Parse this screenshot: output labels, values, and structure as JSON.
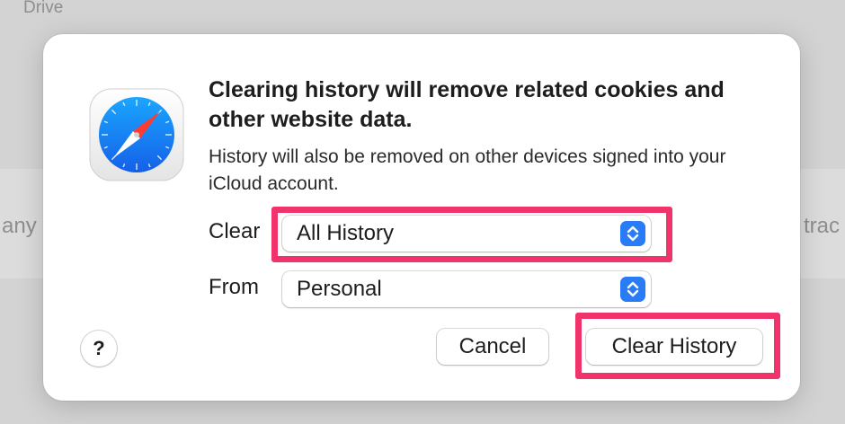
{
  "background": {
    "window_label": "Drive",
    "left_fragment": "any",
    "right_fragment": "trac"
  },
  "dialog": {
    "app_icon": "safari-compass-icon",
    "title": "Clearing history will remove related cookies and other website data.",
    "message": "History will also be removed on other devices signed into your iCloud account.",
    "clear_label": "Clear",
    "clear_value": "All History",
    "from_label": "From",
    "from_value": "Personal",
    "help_label": "?",
    "cancel_label": "Cancel",
    "confirm_label": "Clear History"
  },
  "colors": {
    "highlight": "#f0336b",
    "accent": "#2a7cf6"
  }
}
